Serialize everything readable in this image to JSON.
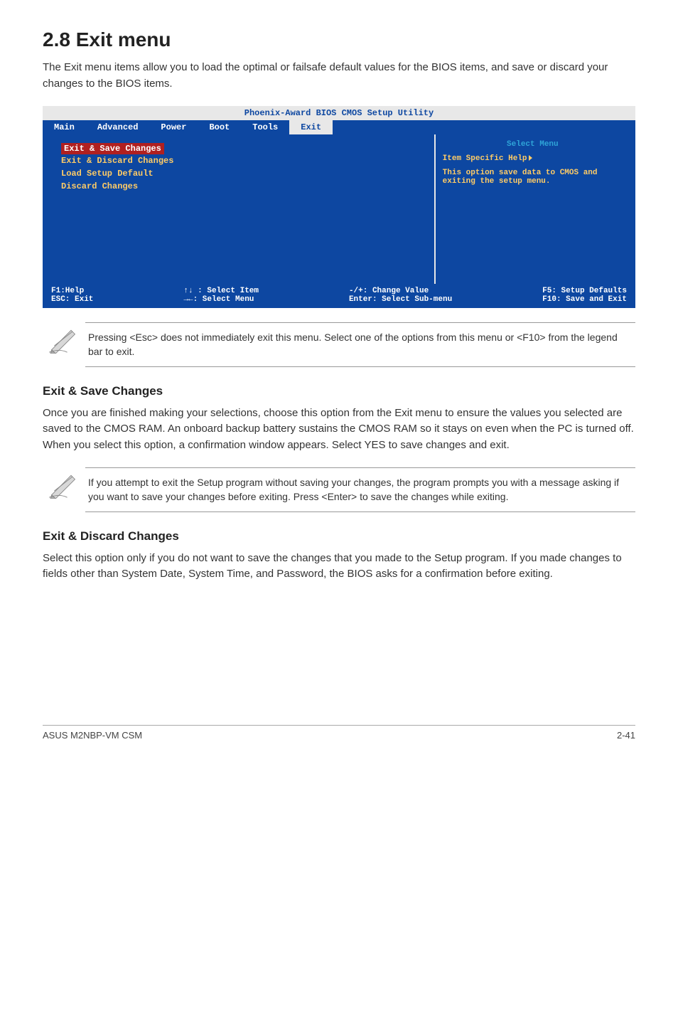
{
  "section": {
    "title": "2.8    Exit menu",
    "intro": "The Exit menu items allow you to load the optimal or failsafe default values for the BIOS items, and save or discard your changes to the BIOS items."
  },
  "bios": {
    "title": "Phoenix-Award BIOS CMOS Setup Utility",
    "tabs": [
      "Main",
      "Advanced",
      "Power",
      "Boot",
      "Tools",
      "Exit"
    ],
    "active_tab": "Exit",
    "items": {
      "highlight": "Exit & Save Changes",
      "i1": "Exit & Discard Changes",
      "i2": "Load Setup Default",
      "i3": "Discard Changes"
    },
    "help": {
      "title": "Select Menu",
      "specific": "Item Specific Help",
      "body": "This option save data to CMOS and exiting the setup menu."
    },
    "footer": {
      "f1": "F1:Help",
      "updown": "↑↓ : Select Item",
      "change": "-/+: Change Value",
      "f5": "F5: Setup Defaults",
      "esc": "ESC: Exit",
      "leftright": "→←: Select Menu",
      "enter": "Enter: Select Sub-menu",
      "f10": "F10: Save and Exit"
    }
  },
  "note1": "Pressing <Esc> does not immediately exit this menu. Select one of the options from this menu or <F10> from the legend bar to exit.",
  "sub1": {
    "title": "Exit & Save Changes",
    "body": "Once you are finished making your selections, choose this option from the Exit menu to ensure the values you selected are saved to the CMOS RAM. An onboard backup battery sustains the CMOS RAM so it stays on even when the PC is turned off. When you select this option, a confirmation window appears. Select YES to save changes and exit."
  },
  "note2": " If you attempt to exit the Setup program without saving your changes, the program prompts you with a message asking if you want to save your changes before exiting. Press <Enter>  to save the  changes while exiting.",
  "sub2": {
    "title": "Exit & Discard Changes",
    "body": "Select this option only if you do not want to save the changes that you  made to the Setup program. If you made changes to fields other than System Date, System Time, and Password, the BIOS asks for a confirmation before exiting."
  },
  "footer": {
    "left": "ASUS M2NBP-VM CSM",
    "right": "2-41"
  }
}
